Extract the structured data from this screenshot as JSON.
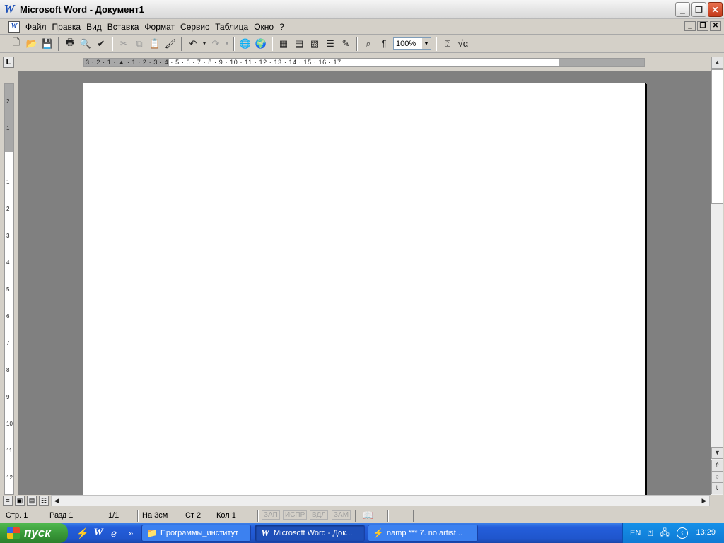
{
  "window": {
    "title": "Microsoft Word - Документ1",
    "app_icon": "W"
  },
  "menu": {
    "items": [
      {
        "label": "Файл"
      },
      {
        "label": "Правка"
      },
      {
        "label": "Вид"
      },
      {
        "label": "Вставка"
      },
      {
        "label": "Формат"
      },
      {
        "label": "Сервис"
      },
      {
        "label": "Таблица"
      },
      {
        "label": "Окно"
      },
      {
        "label": "?"
      }
    ]
  },
  "toolbar": {
    "zoom": "100%",
    "icons": [
      "new-document-icon",
      "open-folder-icon",
      "save-icon",
      "print-icon",
      "print-preview-icon",
      "spelling-icon",
      "cut-icon",
      "copy-icon",
      "paste-icon",
      "format-painter-icon",
      "undo-icon",
      "redo-icon",
      "hyperlink-icon",
      "web-toolbar-icon",
      "tables-borders-icon",
      "insert-table-icon",
      "insert-excel-icon",
      "columns-icon",
      "drawing-icon",
      "document-map-icon",
      "show-formatting-icon",
      "help-icon",
      "equation-icon"
    ]
  },
  "ruler": {
    "h_numbers": "3 · 2 · 1 · ▲ · 1 · 2 · 3 · 4 · 5 · 6 · 7 · 8 · 9 · 10 · 11 · 12 · 13 · 14 · 15 · 16 · 17",
    "v_numbers": [
      "2",
      "1",
      "1",
      "2",
      "3",
      "4",
      "5",
      "6",
      "7",
      "8",
      "9",
      "10",
      "11",
      "12"
    ]
  },
  "status": {
    "page": "Стр. 1",
    "section": "Разд 1",
    "pages": "1/1",
    "at": "На 3см",
    "line": "Ст 2",
    "col": "Кол 1",
    "rec": "ЗАП",
    "trk": "ИСПР",
    "ext": "ВДЛ",
    "ovr": "ЗАМ"
  },
  "taskbar": {
    "start_label": "пуск",
    "tasks": [
      {
        "label": "Программы_институт"
      },
      {
        "label": "Microsoft Word - Док..."
      },
      {
        "label": "namp *** 7. no artist..."
      }
    ],
    "tray": {
      "lang": "EN",
      "clock": "13:29"
    }
  },
  "colors": {
    "workspace": "#808080",
    "taskbar": "#245edb",
    "start": "#3a9a3a"
  }
}
